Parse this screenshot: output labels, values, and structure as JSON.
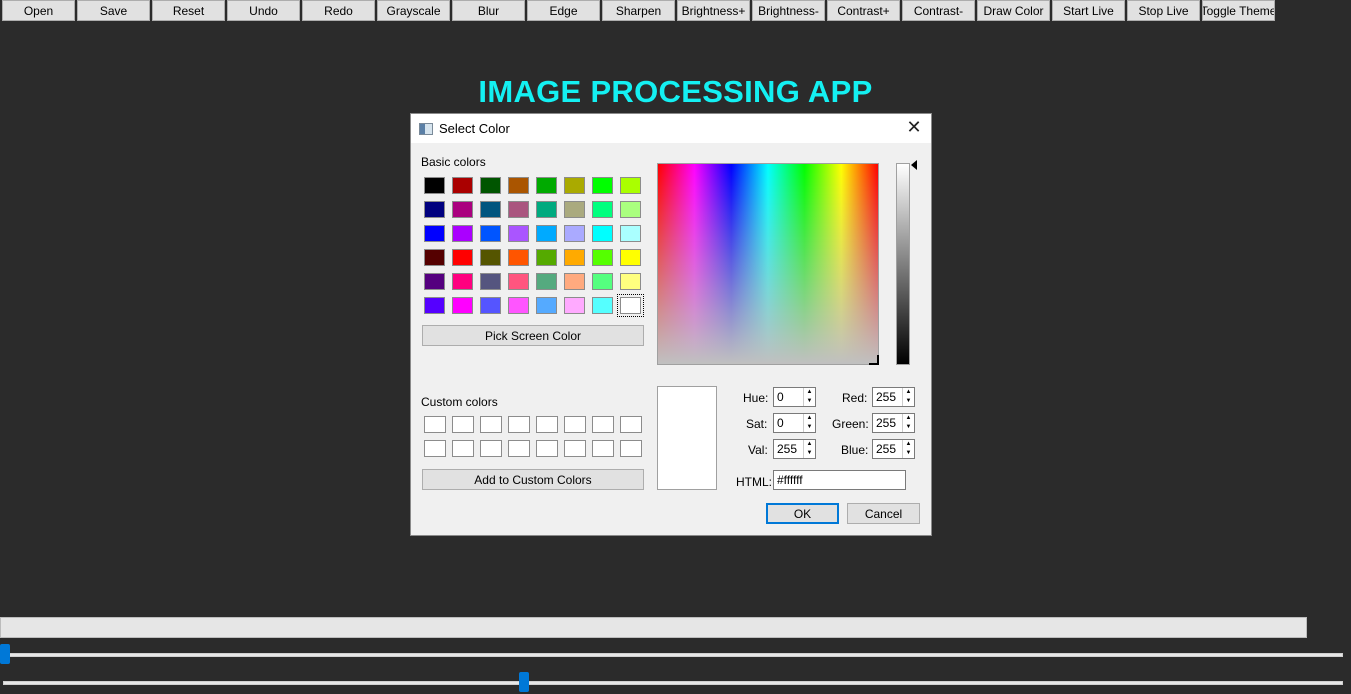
{
  "toolbar": {
    "buttons": [
      "Open",
      "Save",
      "Reset",
      "Undo",
      "Redo",
      "Grayscale",
      "Blur",
      "Edge",
      "Sharpen",
      "Brightness+",
      "Brightness-",
      "Contrast+",
      "Contrast-",
      "Draw Color",
      "Start Live",
      "Stop Live",
      "Toggle Theme"
    ]
  },
  "app": {
    "title": "IMAGE PROCESSING APP",
    "title_color": "#14f0f2"
  },
  "dialog": {
    "title": "Select Color",
    "basic_colors_label": "Basic colors",
    "basic_colors": [
      [
        "#000000",
        "#aa0000",
        "#005500",
        "#aa5500",
        "#00aa00",
        "#aaaa00",
        "#00ff00",
        "#aaff00"
      ],
      [
        "#00007f",
        "#aa007f",
        "#00557f",
        "#aa557f",
        "#00aa7f",
        "#aaaa7f",
        "#00ff7f",
        "#aaff7f"
      ],
      [
        "#0000ff",
        "#aa00ff",
        "#0055ff",
        "#aa55ff",
        "#00aaff",
        "#aaaaff",
        "#00ffff",
        "#aaffff"
      ],
      [
        "#550000",
        "#ff0000",
        "#555500",
        "#ff5500",
        "#55aa00",
        "#ffaa00",
        "#55ff00",
        "#ffff00"
      ],
      [
        "#55007f",
        "#ff007f",
        "#55557f",
        "#ff557f",
        "#55aa7f",
        "#ffaa7f",
        "#55ff7f",
        "#ffff7f"
      ],
      [
        "#5500ff",
        "#ff00ff",
        "#5555ff",
        "#ff55ff",
        "#55aaff",
        "#ffaaff",
        "#55ffff",
        "#ffffff"
      ]
    ],
    "pick_screen_color": "Pick Screen Color",
    "custom_colors_label": "Custom colors",
    "add_custom": "Add to Custom Colors",
    "fields": {
      "hue_label": "Hue:",
      "hue": "0",
      "sat_label": "Sat:",
      "sat": "0",
      "val_label": "Val:",
      "val": "255",
      "red_label": "Red:",
      "red": "255",
      "green_label": "Green:",
      "green": "255",
      "blue_label": "Blue:",
      "blue": "255",
      "html_label": "HTML:",
      "html": "#ffffff"
    },
    "ok": "OK",
    "cancel": "Cancel"
  },
  "sliders": [
    0.0,
    0.39
  ]
}
